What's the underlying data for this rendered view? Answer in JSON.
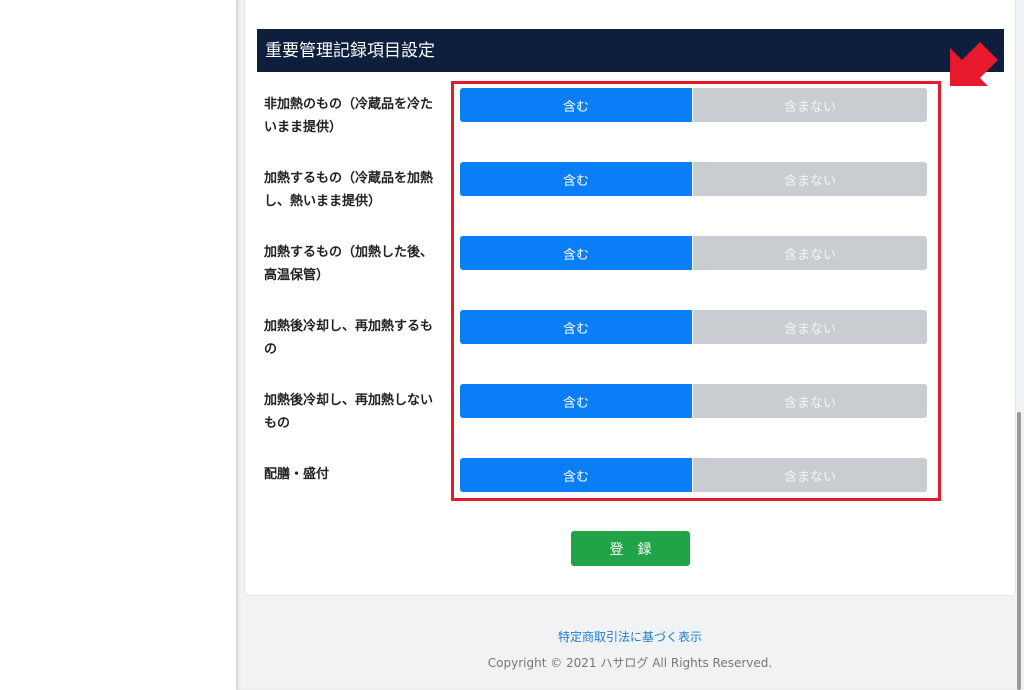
{
  "section": {
    "title": "重要管理記録項目設定"
  },
  "settings": {
    "rows": [
      {
        "label": "非加熱のもの（冷蔵品を冷たいまま提供）",
        "include": "含む",
        "exclude": "含まない"
      },
      {
        "label": "加熱するもの（冷蔵品を加熱し、熱いまま提供）",
        "include": "含む",
        "exclude": "含まない"
      },
      {
        "label": "加熱するもの（加熱した後、高温保管）",
        "include": "含む",
        "exclude": "含まない"
      },
      {
        "label": "加熱後冷却し、再加熱するもの",
        "include": "含む",
        "exclude": "含まない"
      },
      {
        "label": "加熱後冷却し、再加熱しないもの",
        "include": "含む",
        "exclude": "含まない"
      },
      {
        "label": "配膳・盛付",
        "include": "含む",
        "exclude": "含まない"
      }
    ],
    "selected": "include"
  },
  "form": {
    "submit_label": "登録"
  },
  "footer": {
    "link_text": "特定商取引法に基づく表示",
    "copyright": "Copyright © 2021 ハサログ All Rights Reserved."
  },
  "colors": {
    "header_bg": "#0d1f3c",
    "selected": "#0a7ef7",
    "unselected": "#c9ccd0",
    "submit": "#21a447",
    "highlight": "#e8192c"
  },
  "icons": {
    "annotation": "arrow-icon"
  }
}
